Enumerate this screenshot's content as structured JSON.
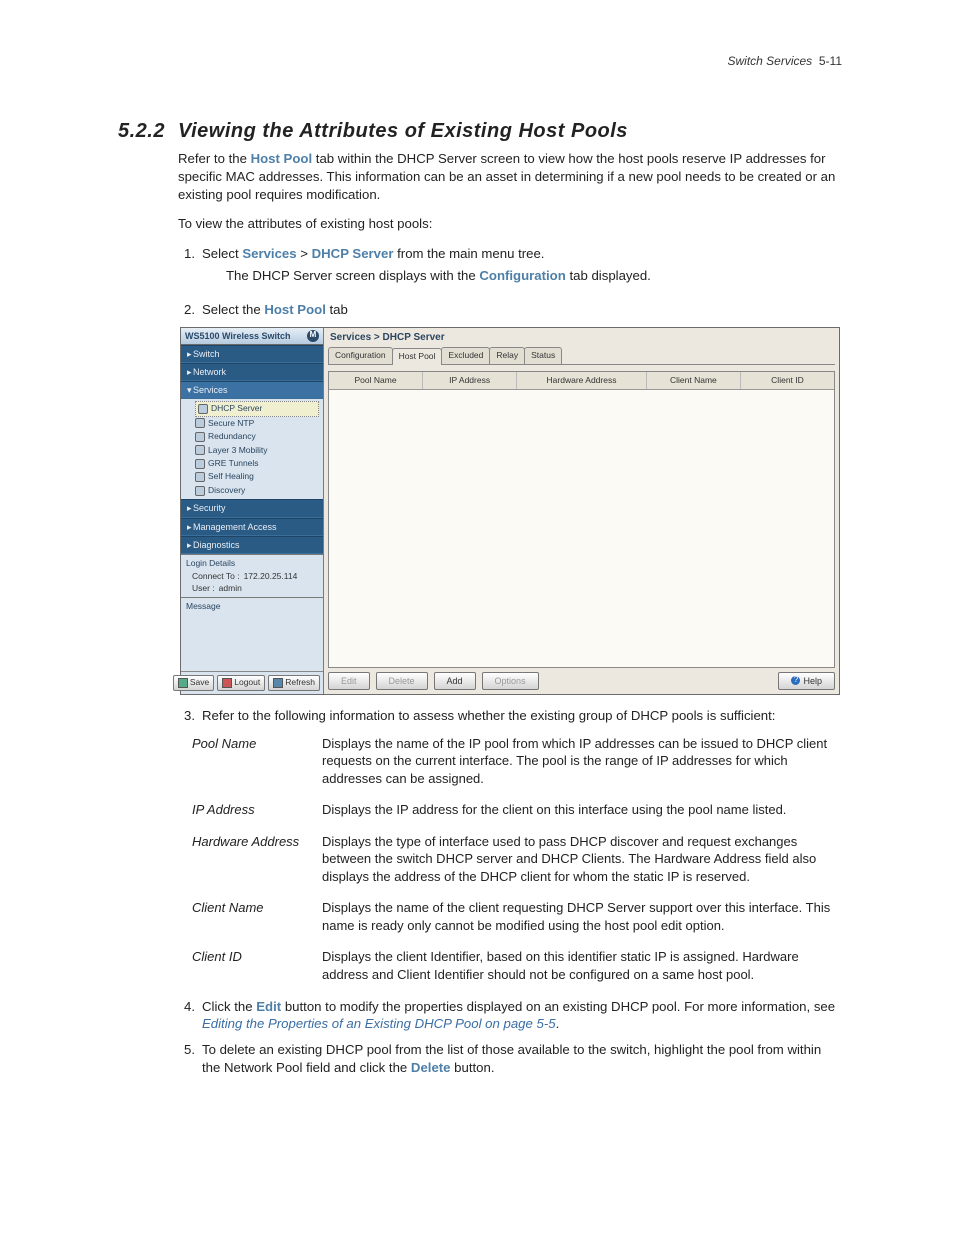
{
  "runhead": {
    "title": "Switch Services",
    "page": "5-11"
  },
  "section": {
    "num": "5.2.2",
    "title": "Viewing the Attributes of Existing Host Pools"
  },
  "intro": {
    "prefix": "Refer to the ",
    "hp": "Host Pool",
    "rest": " tab within the DHCP Server screen to view how the host pools reserve IP addresses for specific MAC addresses. This information can be an asset in determining if a new pool needs to be created or an existing pool requires modification."
  },
  "lead": "To view the attributes of existing host pools:",
  "steps": {
    "s1": {
      "n": "1.",
      "a": "Select ",
      "services": "Services",
      "gt": " > ",
      "dhcp": "DHCP Server",
      "b": " from the main menu tree."
    },
    "s1b": {
      "a": "The DHCP Server screen displays with the ",
      "conf": "Configuration",
      "b": " tab displayed."
    },
    "s2": {
      "n": "2.",
      "a": "Select the ",
      "hp": "Host Pool",
      "b": " tab"
    },
    "s3": {
      "n": "3.",
      "a": "Refer to the following information to assess whether the existing group of DHCP pools is sufficient:"
    },
    "s4": {
      "n": "4.",
      "a": "Click the ",
      "edit": "Edit",
      "b": " button to modify the properties displayed on an existing DHCP pool. For more information, see ",
      "link": "Editing the Properties of an Existing DHCP Pool on page 5-5",
      "c": "."
    },
    "s5": {
      "n": "5.",
      "a": "To delete an existing DHCP pool from the list of those available to the switch, highlight the pool from within the Network Pool field and click the ",
      "del": "Delete",
      "b": " button."
    }
  },
  "fields": [
    {
      "name": "Pool Name",
      "desc": "Displays the name of the IP pool from which IP addresses can be issued to DHCP client requests on the current interface. The pool is the range of IP addresses for which addresses can be assigned."
    },
    {
      "name": "IP Address",
      "desc": "Displays the IP address for the client on this interface using the pool name listed."
    },
    {
      "name": "Hardware Address",
      "desc": "Displays the type of interface used to pass DHCP discover and request exchanges between the switch DHCP server and DHCP Clients. The Hardware Address field also displays the address of the DHCP client for whom the static IP is reserved."
    },
    {
      "name": "Client Name",
      "desc": "Displays the name of the client requesting DHCP Server support over this interface. This name is ready only cannot be modified using the host pool edit option."
    },
    {
      "name": "Client ID",
      "desc": "Displays the client Identifier, based on this identifier static IP is assigned. Hardware address and Client Identifier should not be configured on a same host pool."
    }
  ],
  "shot": {
    "title": "WS5100 Wireless Switch",
    "nav": [
      "Switch",
      "Network",
      "Services"
    ],
    "sub": [
      "DHCP Server",
      "Secure NTP",
      "Redundancy",
      "Layer 3 Mobility",
      "GRE Tunnels",
      "Self Healing",
      "Discovery"
    ],
    "nav2": [
      "Security",
      "Management Access",
      "Diagnostics"
    ],
    "login": {
      "hd": "Login Details",
      "l1a": "Connect To :",
      "l1b": "172.20.25.114",
      "l2a": "User :",
      "l2b": "admin"
    },
    "msg": "Message",
    "btns": {
      "save": "Save",
      "logout": "Logout",
      "refresh": "Refresh"
    },
    "crumb": "Services > DHCP Server",
    "tabs": [
      "Configuration",
      "Host Pool",
      "Excluded",
      "Relay",
      "Status"
    ],
    "cols": [
      "Pool Name",
      "IP Address",
      "Hardware Address",
      "Client Name",
      "Client ID"
    ],
    "actions": {
      "edit": "Edit",
      "del": "Delete",
      "add": "Add",
      "opt": "Options",
      "help": "Help"
    }
  }
}
